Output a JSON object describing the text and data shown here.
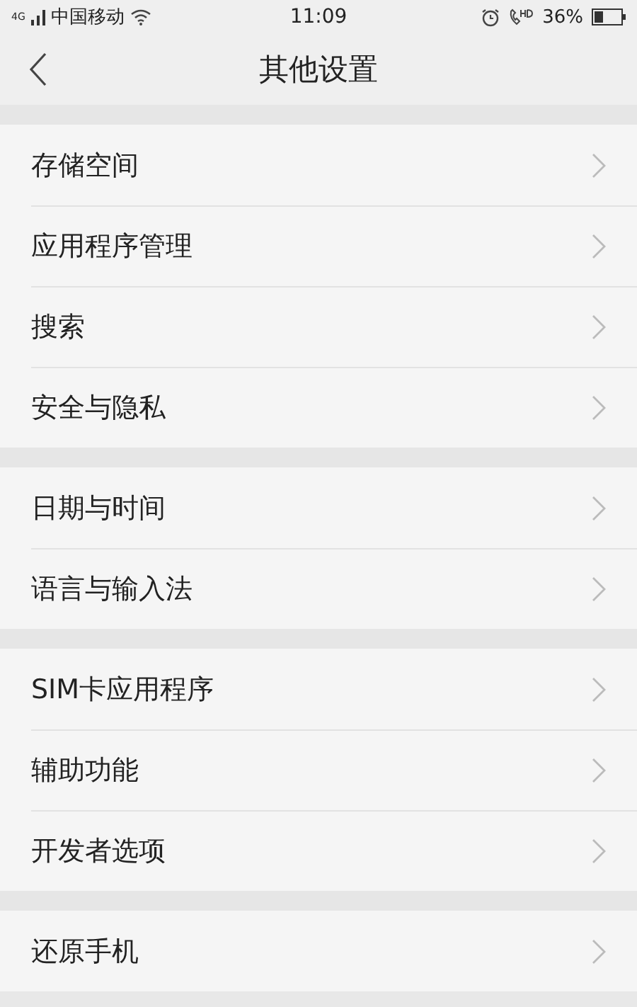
{
  "status_bar": {
    "network": "4G",
    "carrier": "中国移动",
    "time": "11:09",
    "battery_text": "36%"
  },
  "header": {
    "title": "其他设置"
  },
  "groups": [
    {
      "items": [
        {
          "label": "存储空间"
        },
        {
          "label": "应用程序管理"
        },
        {
          "label": "搜索"
        },
        {
          "label": "安全与隐私"
        }
      ]
    },
    {
      "items": [
        {
          "label": "日期与时间"
        },
        {
          "label": "语言与输入法"
        }
      ]
    },
    {
      "items": [
        {
          "label": "SIM卡应用程序"
        },
        {
          "label": "辅助功能"
        },
        {
          "label": "开发者选项"
        }
      ]
    },
    {
      "items": [
        {
          "label": "还原手机"
        }
      ]
    }
  ]
}
